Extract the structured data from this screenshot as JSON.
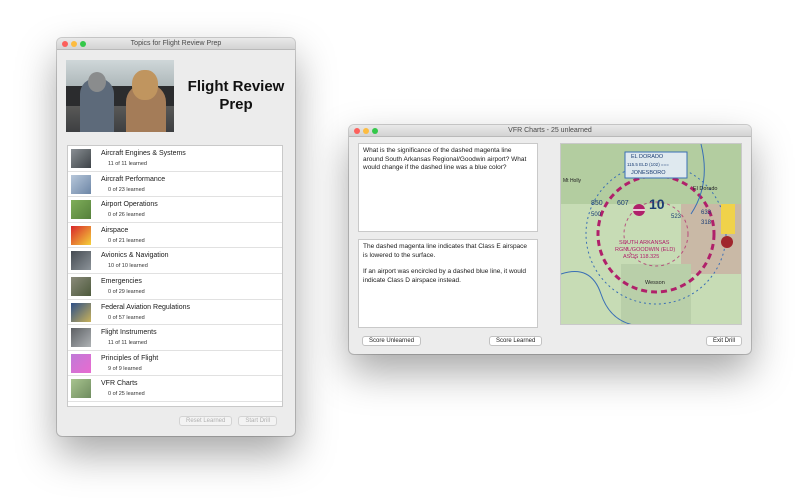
{
  "topics_window": {
    "title": "Topics for Flight Review Prep",
    "app_title": "Flight Review Prep",
    "topics": [
      {
        "name": "Aircraft Engines & Systems",
        "count": "11 of 11 learned",
        "icon": "engine-icon"
      },
      {
        "name": "Aircraft Performance",
        "count": "0 of 23 learned",
        "icon": "performance-icon"
      },
      {
        "name": "Airport Operations",
        "count": "0 of 26 learned",
        "icon": "airport-icon"
      },
      {
        "name": "Airspace",
        "count": "0 of 21 learned",
        "icon": "airspace-icon"
      },
      {
        "name": "Avionics & Navigation",
        "count": "10 of 10 learned",
        "icon": "avionics-icon"
      },
      {
        "name": "Emergencies",
        "count": "0 of 29 learned",
        "icon": "emergency-icon"
      },
      {
        "name": "Federal Aviation Regulations",
        "count": "0 of 57 learned",
        "icon": "faa-seal-icon"
      },
      {
        "name": "Flight Instruments",
        "count": "11 of 11 learned",
        "icon": "instruments-icon"
      },
      {
        "name": "Principles of Flight",
        "count": "9 of 9 learned",
        "icon": "wing-icon"
      },
      {
        "name": "VFR Charts",
        "count": "0 of 25 learned",
        "icon": "chart-icon"
      }
    ],
    "reset_label": "Reset Learned",
    "start_label": "Start Drill"
  },
  "drill_window": {
    "title": "VFR Charts - 25 unlearned",
    "question": "What is the significance of the dashed magenta line around South Arkansas Regional/Goodwin airport? What would change if the dashed line was a blue color?",
    "answer_p1": "The dashed magenta line indicates that Class E airspace is lowered to the surface.",
    "answer_p2": "If an airport was encircled by a dashed blue line, it would indicate Class D airspace instead.",
    "score_unlearned_label": "Score Unlearned",
    "score_learned_label": "Score Learned",
    "exit_label": "Exit Drill",
    "chart_labels": {
      "el_dorado_box": "EL DORADO",
      "freq": "115.5 ELD (102) ===",
      "jonesboro": "JONESBORO",
      "town1": "El Dorado",
      "airport": "SOUTH ARKANSAS",
      "airport2": "RGNL/GOODWIN (ELD)",
      "asos": "ASOS 118.325",
      "wesson": "Wesson",
      "mt_holly": "Mt Holly",
      "num1": "850",
      "num2": "607",
      "num3": "10",
      "num4": "523",
      "num5": "633",
      "num6": "318",
      "num7": "500"
    }
  },
  "colors": {
    "magenta": "#b0206a",
    "chart_green": "#b9d3a6",
    "chart_blue": "#3a6fb5"
  }
}
